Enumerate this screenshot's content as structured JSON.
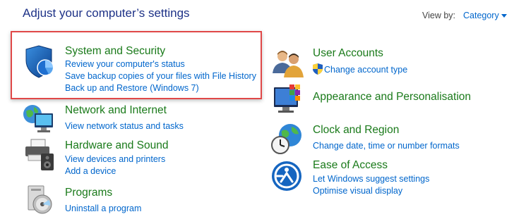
{
  "header": {
    "title": "Adjust your computer’s settings",
    "view_by_label": "View by:",
    "view_by_value": "Category"
  },
  "left_categories": [
    {
      "title": "System and Security",
      "icon": "security-shield-icon",
      "links": [
        "Review your computer's status",
        "Save backup copies of your files with File History",
        "Back up and Restore (Windows 7)"
      ]
    },
    {
      "title": "Network and Internet",
      "icon": "network-globe-icon",
      "links": [
        "View network status and tasks"
      ]
    },
    {
      "title": "Hardware and Sound",
      "icon": "printer-speaker-icon",
      "links": [
        "View devices and printers",
        "Add a device"
      ]
    },
    {
      "title": "Programs",
      "icon": "programs-disc-icon",
      "links": [
        "Uninstall a program"
      ]
    }
  ],
  "right_categories": [
    {
      "title": "User Accounts",
      "icon": "users-icon",
      "links": [
        "Change account type"
      ]
    },
    {
      "title": "Appearance and Personalisation",
      "icon": "monitor-palette-icon",
      "links": []
    },
    {
      "title": "Clock and Region",
      "icon": "clock-globe-icon",
      "links": [
        "Change date, time or number formats"
      ]
    },
    {
      "title": "Ease of Access",
      "icon": "ease-of-access-icon",
      "links": [
        "Let Windows suggest settings",
        "Optimise visual display"
      ]
    }
  ],
  "colors": {
    "title": "#1e3287",
    "category_green": "#1a7a1a",
    "link_blue": "#0066cc",
    "highlight_red": "#e04848"
  }
}
